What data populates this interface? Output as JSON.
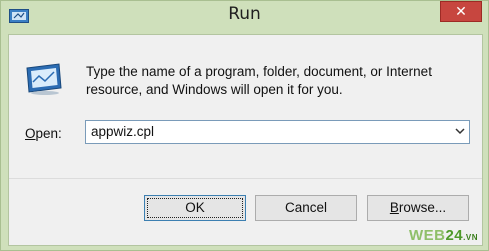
{
  "window": {
    "title": "Run",
    "close_glyph": "✕",
    "app_icon": "run-app-icon"
  },
  "dialog": {
    "description": "Type the name of a program, folder, document, or Internet resource, and Windows will open it for you.",
    "icon": "run-icon",
    "open_label_prefix": "",
    "open_label_mnemonic": "O",
    "open_label_rest": "pen:",
    "open_value": "appwiz.cpl"
  },
  "buttons": {
    "ok": "OK",
    "cancel": "Cancel",
    "browse_mnemonic": "B",
    "browse_rest": "rowse..."
  },
  "watermark": {
    "part1": "WEB",
    "part2": "24",
    "part3": ".VN"
  },
  "colors": {
    "frame": "#cfe0bb",
    "close": "#c7463f",
    "client": "#f0f0f0"
  }
}
